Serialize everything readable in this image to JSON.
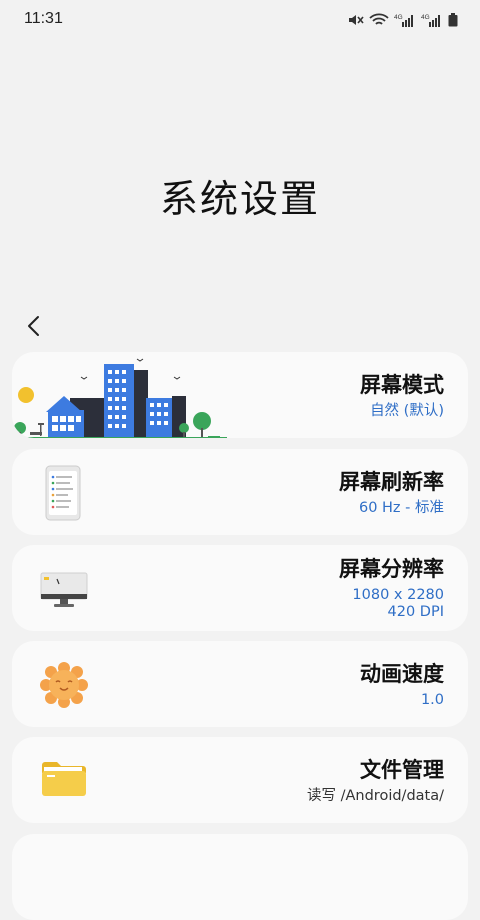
{
  "status_bar": {
    "time": "11:31",
    "icons": [
      "mute-icon",
      "wifi-icon",
      "4g-signal-icon",
      "4g-signal-icon",
      "battery-icon"
    ],
    "network_labels": [
      "4G",
      "4G"
    ]
  },
  "page": {
    "title": "系统设置"
  },
  "cards": [
    {
      "title": "屏幕模式",
      "subtitle": "自然 (默认)",
      "icon": "city-illustration"
    },
    {
      "title": "屏幕刷新率",
      "subtitle": "60 Hz - 标准",
      "icon": "phone-settings-icon"
    },
    {
      "title": "屏幕分辨率",
      "subtitle_line1": "1080 x 2280",
      "subtitle_line2": "420 DPI",
      "icon": "monitor-icon"
    },
    {
      "title": "动画速度",
      "subtitle": "1.0",
      "icon": "sun-face-icon"
    },
    {
      "title": "文件管理",
      "subtitle": "读写 /Android/data/",
      "icon": "folder-icon"
    }
  ],
  "colors": {
    "accent": "#2f6ec6",
    "card_bg": "#fafafa",
    "page_bg": "#f2f2f2"
  }
}
